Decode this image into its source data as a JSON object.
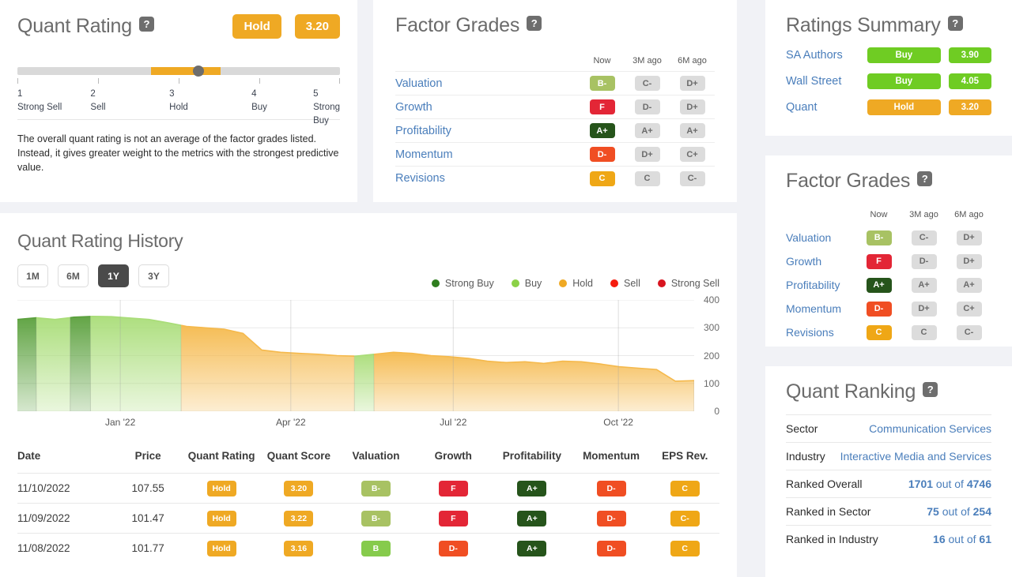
{
  "quant_rating": {
    "title": "Quant Rating",
    "help": "?",
    "rating_label": "Hold",
    "score": "3.20",
    "scale": [
      {
        "num": "1",
        "label": "Strong Sell"
      },
      {
        "num": "2",
        "label": "Sell"
      },
      {
        "num": "3",
        "label": "Hold"
      },
      {
        "num": "4",
        "label": "Buy"
      },
      {
        "num": "5",
        "label": "Strong Buy"
      }
    ],
    "note": "The overall quant rating is not an average of the factor grades listed. Instead, it gives greater weight to the metrics with the strongest predictive value."
  },
  "factor_grades": {
    "title": "Factor Grades",
    "help": "?",
    "columns": [
      "Now",
      "3M ago",
      "6M ago"
    ],
    "rows": [
      {
        "name": "Valuation",
        "now": "B-",
        "now_cls": "g-bminus",
        "m3": "C-",
        "m6": "D+"
      },
      {
        "name": "Growth",
        "now": "F",
        "now_cls": "g-f",
        "m3": "D-",
        "m6": "D+"
      },
      {
        "name": "Profitability",
        "now": "A+",
        "now_cls": "g-aplus",
        "m3": "A+",
        "m6": "A+"
      },
      {
        "name": "Momentum",
        "now": "D-",
        "now_cls": "g-d",
        "m3": "D+",
        "m6": "C+"
      },
      {
        "name": "Revisions",
        "now": "C",
        "now_cls": "g-c",
        "m3": "C",
        "m6": "C-"
      }
    ]
  },
  "ratings_summary": {
    "title": "Ratings Summary",
    "help": "?",
    "rows": [
      {
        "name": "SA Authors",
        "rating": "Buy",
        "score": "3.90",
        "cls": "g-buy"
      },
      {
        "name": "Wall Street",
        "rating": "Buy",
        "score": "4.05",
        "cls": "g-buy"
      },
      {
        "name": "Quant",
        "rating": "Hold",
        "score": "3.20",
        "cls": "g-hold"
      }
    ]
  },
  "quant_ranking": {
    "title": "Quant Ranking",
    "help": "?",
    "rows": [
      {
        "label": "Sector",
        "value": "Communication Services",
        "type": "link"
      },
      {
        "label": "Industry",
        "value": "Interactive Media and Services",
        "type": "link"
      },
      {
        "label": "Ranked Overall",
        "rank": "1701",
        "of": "4746",
        "type": "rank"
      },
      {
        "label": "Ranked in Sector",
        "rank": "75",
        "of": "254",
        "type": "rank"
      },
      {
        "label": "Ranked in Industry",
        "rank": "16",
        "of": "61",
        "type": "rank"
      }
    ],
    "out_of_text": "out of"
  },
  "rating_history": {
    "title": "Quant Rating History",
    "ranges": [
      {
        "label": "1M",
        "active": false
      },
      {
        "label": "6M",
        "active": false
      },
      {
        "label": "1Y",
        "active": true
      },
      {
        "label": "3Y",
        "active": false
      }
    ],
    "columns": [
      "Date",
      "Price",
      "Quant Rating",
      "Quant Score",
      "Valuation",
      "Growth",
      "Profitability",
      "Momentum",
      "EPS Rev."
    ],
    "rows": [
      {
        "date": "11/10/2022",
        "price": "107.55",
        "rating": "Hold",
        "rating_cls": "g-hold",
        "score": "3.20",
        "valuation": "B-",
        "valuation_cls": "g-bminus",
        "growth": "F",
        "growth_cls": "g-f",
        "profitability": "A+",
        "profitability_cls": "g-aplus",
        "momentum": "D-",
        "momentum_cls": "g-d",
        "eps": "C",
        "eps_cls": "g-c"
      },
      {
        "date": "11/09/2022",
        "price": "101.47",
        "rating": "Hold",
        "rating_cls": "g-hold",
        "score": "3.22",
        "valuation": "B-",
        "valuation_cls": "g-bminus",
        "growth": "F",
        "growth_cls": "g-f",
        "profitability": "A+",
        "profitability_cls": "g-aplus",
        "momentum": "D-",
        "momentum_cls": "g-d",
        "eps": "C-",
        "eps_cls": "g-c"
      },
      {
        "date": "11/08/2022",
        "price": "101.77",
        "rating": "Hold",
        "rating_cls": "g-hold",
        "score": "3.16",
        "valuation": "B",
        "valuation_cls": "g-b",
        "growth": "D-",
        "growth_cls": "g-d",
        "profitability": "A+",
        "profitability_cls": "g-aplus",
        "momentum": "D-",
        "momentum_cls": "g-d",
        "eps": "C",
        "eps_cls": "g-c"
      }
    ]
  },
  "chart_data": {
    "type": "area",
    "title": "Quant Rating History",
    "xlabel": "",
    "ylabel": "",
    "ylim": [
      0,
      400
    ],
    "yticks": [
      0,
      100,
      200,
      300,
      400
    ],
    "grid": true,
    "legend_position": "top-right",
    "legend": [
      {
        "name": "Strong Buy",
        "color": "#2e7d1e"
      },
      {
        "name": "Buy",
        "color": "#8bd147"
      },
      {
        "name": "Hold",
        "color": "#efa924"
      },
      {
        "name": "Sell",
        "color": "#f51c0e"
      },
      {
        "name": "Strong Sell",
        "color": "#d8141f"
      }
    ],
    "xticks": [
      "Jan '22",
      "Apr '22",
      "Jul '22",
      "Oct '22"
    ],
    "xtick_positions": [
      0.152,
      0.404,
      0.644,
      0.888
    ],
    "series_name": "Price",
    "x": [
      "2021-11-10",
      "2021-11-20",
      "2021-12-01",
      "2021-12-10",
      "2021-12-20",
      "2022-01-01",
      "2022-01-10",
      "2022-01-20",
      "2022-02-01",
      "2022-02-10",
      "2022-02-20",
      "2022-03-01",
      "2022-03-10",
      "2022-03-20",
      "2022-04-01",
      "2022-04-10",
      "2022-04-20",
      "2022-05-01",
      "2022-05-10",
      "2022-05-20",
      "2022-06-01",
      "2022-06-10",
      "2022-06-20",
      "2022-07-01",
      "2022-07-10",
      "2022-07-20",
      "2022-08-01",
      "2022-08-10",
      "2022-08-20",
      "2022-09-01",
      "2022-09-10",
      "2022-09-20",
      "2022-10-01",
      "2022-10-10",
      "2022-10-20",
      "2022-11-01",
      "2022-11-10"
    ],
    "values": [
      330,
      336,
      330,
      338,
      341,
      340,
      335,
      330,
      318,
      305,
      300,
      295,
      280,
      220,
      212,
      208,
      205,
      200,
      198,
      205,
      212,
      208,
      200,
      196,
      190,
      180,
      175,
      178,
      172,
      180,
      178,
      170,
      160,
      155,
      150,
      108,
      110
    ],
    "rating_bands": [
      {
        "rating": "Strong Buy",
        "color": "#5aa03c",
        "start": 0.0,
        "end": 0.028
      },
      {
        "rating": "Buy",
        "color": "#a9dd78",
        "start": 0.028,
        "end": 0.078
      },
      {
        "rating": "Strong Buy",
        "color": "#5aa03c",
        "start": 0.078,
        "end": 0.108
      },
      {
        "rating": "Buy",
        "color": "#a9dd78",
        "start": 0.108,
        "end": 0.242
      },
      {
        "rating": "Hold",
        "color": "#f5b94c",
        "start": 0.242,
        "end": 0.498
      },
      {
        "rating": "Buy",
        "color": "#a9dd78",
        "start": 0.498,
        "end": 0.527
      },
      {
        "rating": "Hold",
        "color": "#f5b94c",
        "start": 0.527,
        "end": 1.0
      }
    ]
  }
}
